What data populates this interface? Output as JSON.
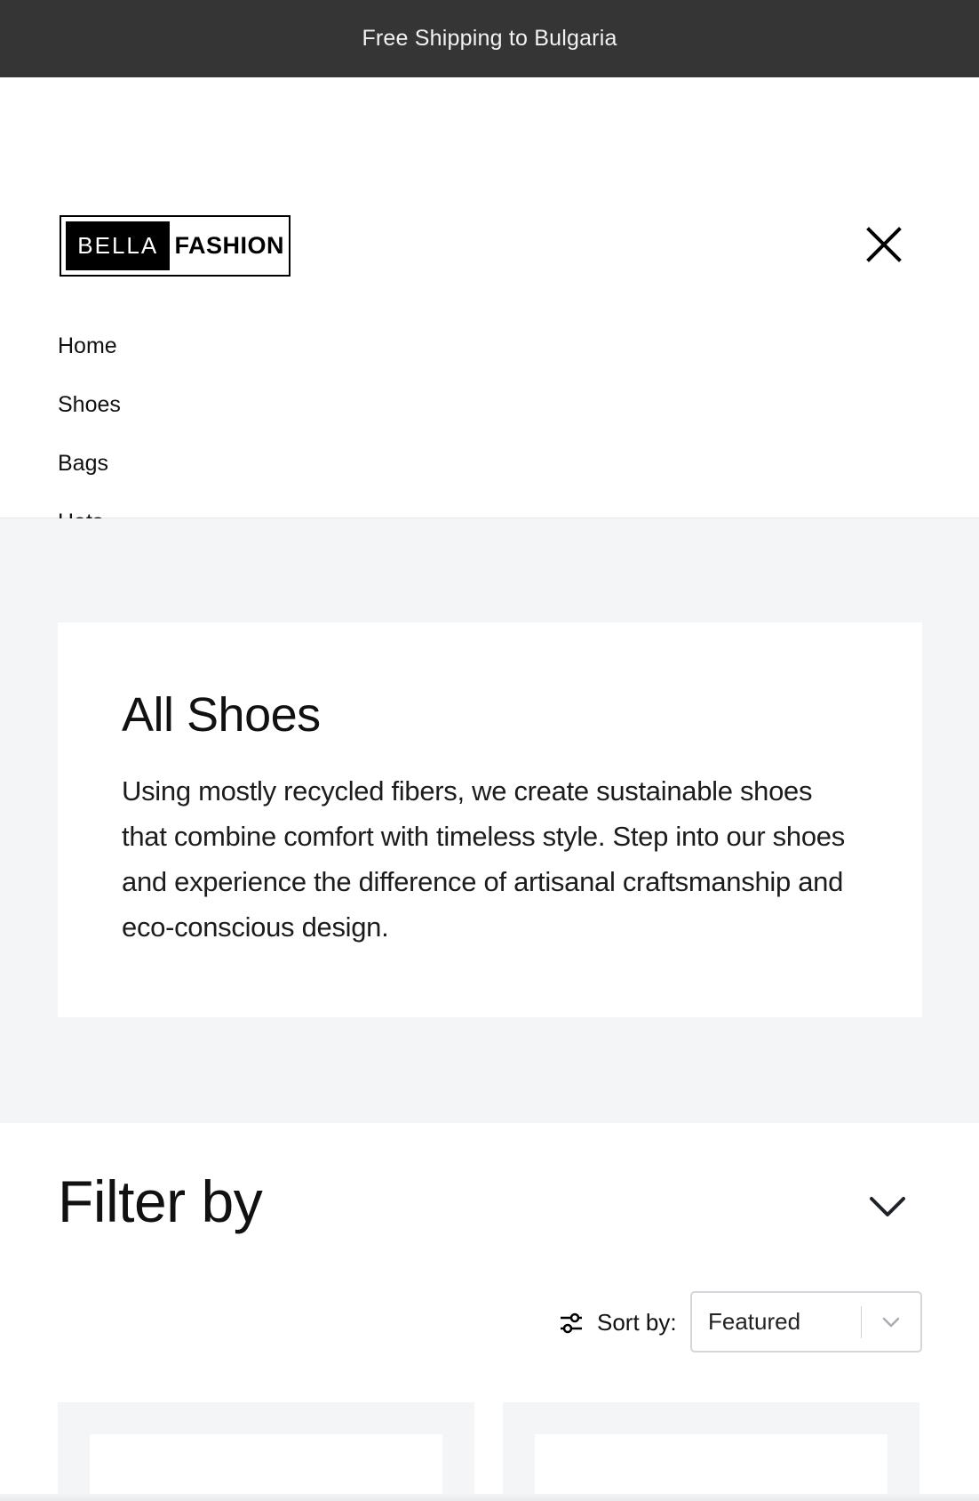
{
  "announcement": {
    "text": "Free Shipping to Bulgaria"
  },
  "header": {
    "logo": {
      "left": "BELLA",
      "right": "FASHION"
    },
    "close_icon": "close-icon"
  },
  "nav": {
    "items": [
      {
        "label": "Home"
      },
      {
        "label": "Shoes"
      },
      {
        "label": "Bags"
      },
      {
        "label": "Hats"
      }
    ]
  },
  "collection": {
    "title": "All Shoes",
    "description": "Using mostly recycled fibers, we create sustainable shoes that combine comfort with timeless style. Step into our shoes and experience the difference of artisanal craftsmanship and eco-conscious design."
  },
  "filter": {
    "title": "Filter by",
    "toggle_icon": "chevron-down-icon"
  },
  "sort": {
    "icon": "sliders-icon",
    "label": "Sort by:",
    "selected": "Featured"
  },
  "colors": {
    "announcement_bg": "#353535",
    "hero_bg": "#f4f5f7",
    "card_bg": "#ffffff",
    "text": "#111111"
  }
}
